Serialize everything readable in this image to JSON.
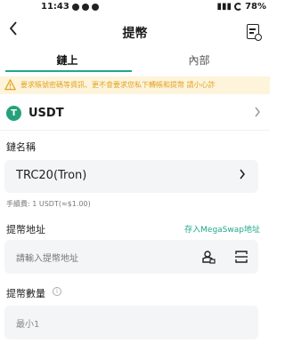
{
  "status_bar": {
    "time": "11:43",
    "battery": "78%"
  },
  "header": {
    "title": "提幣"
  },
  "tabs": [
    {
      "label": "鏈上"
    },
    {
      "label": "內部"
    }
  ],
  "warning": {
    "text": "要求賬號密碼等資訊、更不會要求您私下轉帳和提幣 請小心詐"
  },
  "coin": {
    "symbol": "USDT",
    "icon_letter": "T"
  },
  "chain": {
    "label": "鏈名稱",
    "value": "TRC20(Tron)"
  },
  "fee": {
    "text": "手續費: 1 USDT(≈$1.00)"
  },
  "address": {
    "label": "提幣地址",
    "save_link": "存入MegaSwap地址",
    "placeholder": "請輸入提幣地址"
  },
  "amount": {
    "label": "提幣數量",
    "info_glyph": "i",
    "placeholder": "最小1"
  },
  "colors": {
    "accent": "#1fa88a",
    "warning_bg": "#fdf4db",
    "warning_text": "#e1a323",
    "usdt_green": "#26a17b"
  },
  "icons": [
    "back-arrow-icon",
    "record-icon",
    "warning-icon",
    "usdt-icon",
    "chevron-right-icon",
    "address-book-icon",
    "scan-icon",
    "info-icon"
  ]
}
